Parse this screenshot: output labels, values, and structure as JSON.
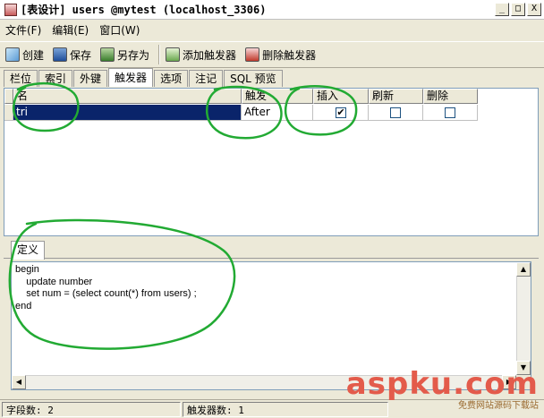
{
  "window": {
    "title": "[表设计] users @mytest (localhost_3306)",
    "controls": [
      "_",
      "□",
      "X"
    ]
  },
  "menu": [
    "文件(F)",
    "编辑(E)",
    "窗口(W)"
  ],
  "toolbar": {
    "create": "创建",
    "save": "保存",
    "save_as": "另存为",
    "add_trigger": "添加触发器",
    "delete_trigger": "删除触发器"
  },
  "tabs": [
    "栏位",
    "索引",
    "外键",
    "触发器",
    "选项",
    "注记",
    "SQL 预览"
  ],
  "active_tab": "触发器",
  "grid": {
    "headers": [
      "名",
      "触发",
      "插入",
      "刷新",
      "删除"
    ],
    "rows": [
      {
        "name": "tri",
        "timing": "After",
        "insert": true,
        "update": false,
        "delete": false
      }
    ]
  },
  "definition": {
    "tab_label": "定义",
    "code": "begin\n    update number\n    set num = (select count(*) from users) ;\nend"
  },
  "status": {
    "field_count": "字段数: 2",
    "trigger_count": "触发器数: 1"
  },
  "watermark": {
    "logo": "aspku.com",
    "tagline": "免费网站源码下载站"
  },
  "annotation_color": "#22aa33"
}
